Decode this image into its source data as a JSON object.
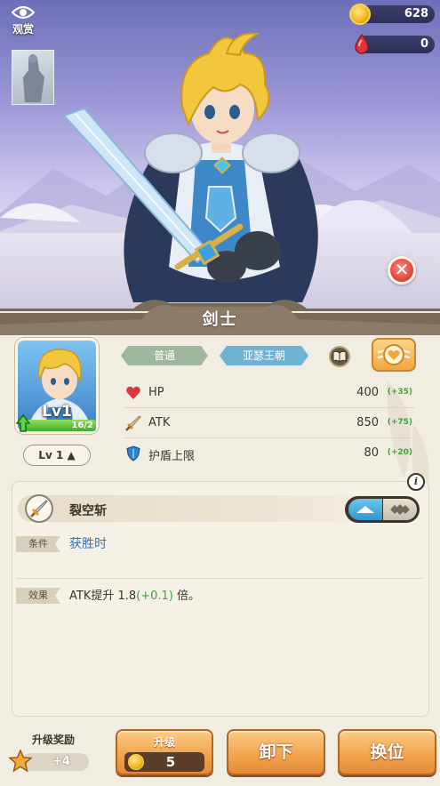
{
  "top": {
    "view_label": "观赏",
    "coins": "628",
    "gems": "0"
  },
  "hero": {
    "name": "剑士",
    "level": "Lv1",
    "exp_text": "16/2",
    "exp_fraction": 1.0,
    "level_button": "Lv 1 ▲",
    "rarity": "普通",
    "faction": "亚瑟王朝"
  },
  "stats": [
    {
      "name": "HP",
      "value": "400",
      "bonus": "(+35)",
      "icon": "heart-icon",
      "color": "#d9363e"
    },
    {
      "name": "ATK",
      "value": "850",
      "bonus": "(+75)",
      "icon": "sword-icon",
      "color": "#c98a3a"
    },
    {
      "name": "护盾上限",
      "value": "80",
      "bonus": "(+20)",
      "icon": "shield-icon",
      "color": "#2f82c9"
    }
  ],
  "skill": {
    "name": "裂空斩",
    "condition_tag": "条件",
    "condition": "获胜时",
    "effect_tag": "效果",
    "effect_prefix": "ATK提升 1.8",
    "effect_bonus": "(+0.1)",
    "effect_suffix": " 倍。",
    "info": "i"
  },
  "bottom": {
    "reward_label": "升级奖励",
    "reward_value": "+4",
    "upgrade_label": "升级",
    "upgrade_cost": "5",
    "unequip_label": "卸下",
    "swap_label": "换位"
  },
  "colors": {
    "accent_orange": "#f3a550",
    "bonus_green": "#3fa33a",
    "condition_blue": "#2f75b5",
    "close_red": "#e0463a"
  }
}
